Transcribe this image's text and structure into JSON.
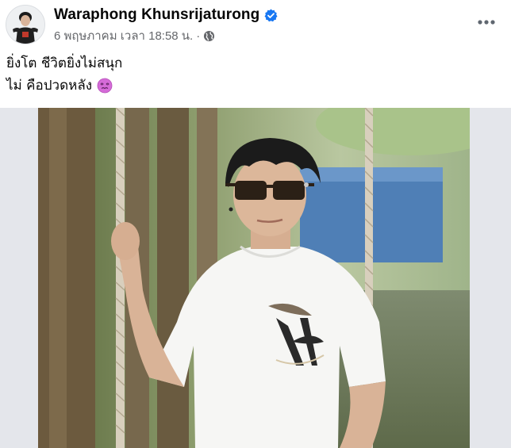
{
  "post": {
    "author_name": "Waraphong Khunsrijaturong",
    "verified_icon": "verified-badge-icon",
    "timestamp": "6 พฤษภาคม เวลา 18:58 น.",
    "separator": "·",
    "audience_icon": "globe-icon",
    "more_icon": "more-horizontal-icon",
    "text_line_1": "ยิ่งโต ชีวิตยิ่งไม่สนุก",
    "text_line_2": "ไม่ คือปวดหลัง",
    "emoji": "face-with-spiral-eyes-emoji",
    "photo": "photo-man-on-rope-swing"
  },
  "colors": {
    "verified": "#1877f2",
    "secondary_text": "#65676b",
    "primary_text": "#050505",
    "media_background": "#e4e6eb"
  }
}
